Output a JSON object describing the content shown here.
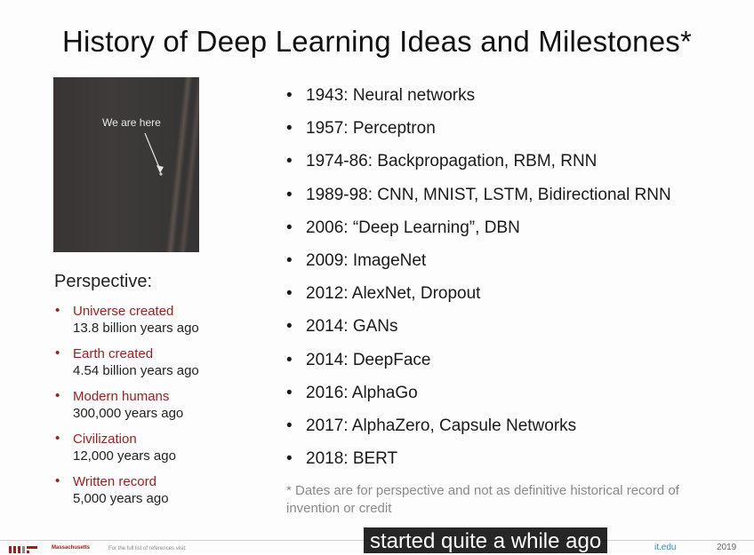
{
  "slide": {
    "title": "History of Deep Learning Ideas and Milestones*",
    "photo_label": "We are here",
    "perspective_title": "Perspective:",
    "perspective": [
      {
        "name": "Universe created",
        "value": "13.8 billion years ago"
      },
      {
        "name": "Earth created",
        "value": "4.54 billion years ago"
      },
      {
        "name": "Modern humans",
        "value": "300,000 years ago"
      },
      {
        "name": "Civilization",
        "value": "12,000 years ago"
      },
      {
        "name": "Written record",
        "value": "5,000 years ago"
      }
    ],
    "milestones": [
      "1943: Neural networks",
      "1957: Perceptron",
      "1974-86: Backpropagation, RBM, RNN",
      "1989-98: CNN, MNIST, LSTM, Bidirectional RNN",
      "2006: “Deep Learning”, DBN",
      "2009: ImageNet",
      "2012: AlexNet, Dropout",
      "2014: GANs",
      "2014: DeepFace",
      "2016: AlphaGo",
      "2017: AlphaZero, Capsule Networks",
      "2018: BERT"
    ],
    "footnote": "* Dates are for perspective and not as definitive historical record of invention or credit",
    "footer": {
      "logo_text": "Massachusetts",
      "reference_text": "For the full list of references visit:",
      "right_text": "it.edu",
      "year": "2019"
    }
  },
  "caption": "started quite a while ago",
  "colors": {
    "accent": "#a51c1c",
    "text": "#1a1a1a",
    "footnote": "#8a8a8a"
  }
}
